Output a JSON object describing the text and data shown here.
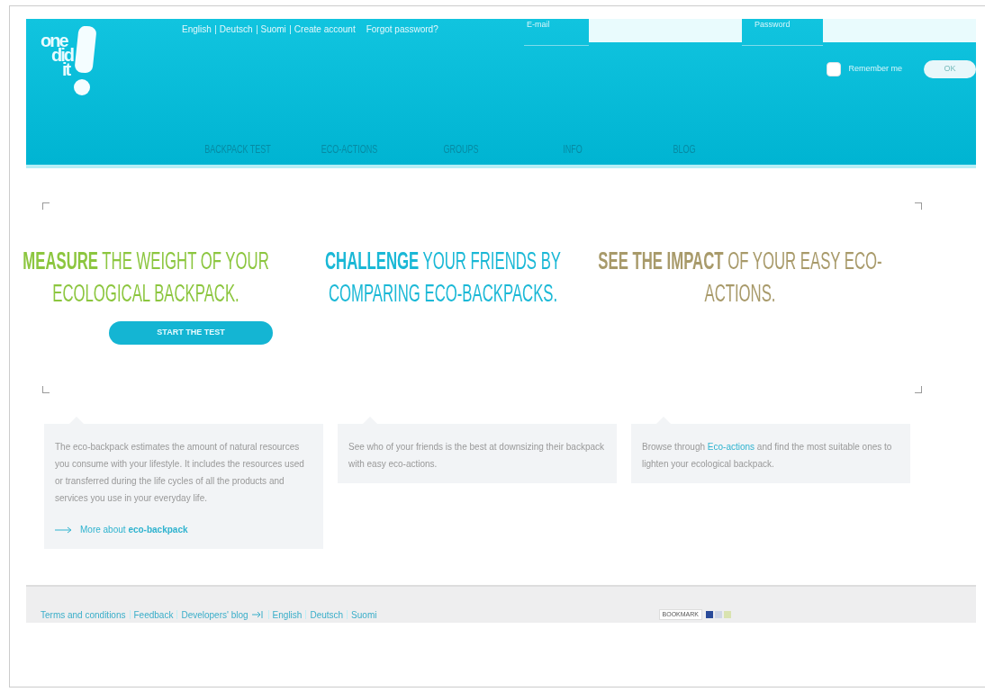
{
  "header": {
    "logo": [
      "one",
      "did",
      "it"
    ],
    "top_links": [
      "English",
      "Deutsch",
      "Suomi",
      "Create account",
      "Forgot password?"
    ],
    "login": {
      "email_label": "E-mail",
      "password_label": "Password",
      "remember_label": "Remember me",
      "remember_checked": false,
      "button": "OK"
    },
    "nav": [
      {
        "label": "BACKPACK TEST",
        "selected": false
      },
      {
        "label": "ECO-ACTIONS",
        "selected": false
      },
      {
        "label": "GROUPS",
        "selected": false
      },
      {
        "label": "INFO",
        "selected": false
      },
      {
        "label": "BLOG",
        "selected": false
      }
    ]
  },
  "columns": [
    {
      "headline": "**MEASURE** THE WEIGHT OF YOUR ECOLOGICAL BACKPACK.",
      "color": "#8cc63f",
      "button": "START THE TEST",
      "callout": {
        "text": "The eco-backpack estimates the amount of natural resources you consume with your lifestyle. It includes the resources used or transferred during the life cycles of all the products and services you use in your everyday life.",
        "more_link": "More about **eco-backpack**"
      }
    },
    {
      "headline": "**CHALLENGE** YOUR FRIENDS BY COMPARING ECO-BACKPACKS.",
      "color": "#1ab8d6",
      "callout": {
        "text": "See who of your friends is the best at downsizing their backpack with easy eco-actions."
      }
    },
    {
      "headline": "**SEE THE IMPACT** OF YOUR EASY ECO-ACTIONS.",
      "color": "#a89a6a",
      "callout": {
        "text": "Browse through",
        "link": "Eco-actions",
        "text_after": "and find the most suitable ones to lighten your ecological backpack."
      }
    }
  ],
  "footer": {
    "links": [
      {
        "kind": "link",
        "label": "Terms and conditions"
      },
      {
        "kind": "link",
        "label": "Feedback"
      },
      {
        "kind": "link",
        "label": "Developers' blog"
      },
      {
        "kind": "icon"
      },
      {
        "kind": "link",
        "label": "English"
      },
      {
        "kind": "link",
        "label": "Deutsch"
      },
      {
        "kind": "link",
        "label": "Suomi"
      }
    ],
    "bookmark": "BOOKMARK"
  }
}
